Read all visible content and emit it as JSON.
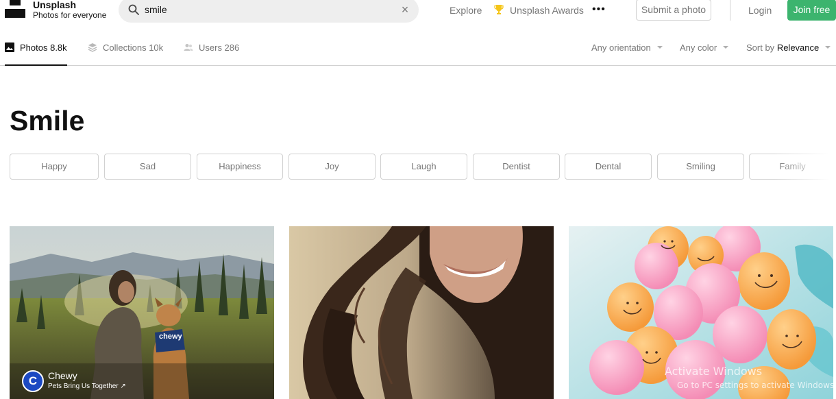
{
  "header": {
    "brand_name": "Unsplash",
    "brand_tagline": "Photos for everyone",
    "search_value": "smile",
    "nav": {
      "explore": "Explore",
      "awards": "Unsplash Awards",
      "more": "•••",
      "submit": "Submit a photo",
      "login": "Login",
      "join": "Join free"
    }
  },
  "tabs": [
    {
      "label": "Photos 8.8k",
      "icon": "image-icon",
      "active": true
    },
    {
      "label": "Collections 10k",
      "icon": "stack-icon",
      "active": false
    },
    {
      "label": "Users 286",
      "icon": "users-icon",
      "active": false
    }
  ],
  "filters": {
    "orientation": "Any orientation",
    "color": "Any color",
    "sort_prefix": "Sort by",
    "sort_value": "Relevance"
  },
  "page_title": "Smile",
  "related_searches": [
    "Happy",
    "Sad",
    "Happiness",
    "Joy",
    "Laugh",
    "Dentist",
    "Dental",
    "Smiling",
    "Family"
  ],
  "photos": [
    {
      "sponsor": "Chewy",
      "sponsor_line": "Pets Bring Us Together ↗",
      "sponsor_initial": "C",
      "collar_text": "chewy"
    },
    {},
    {}
  ],
  "watermark": {
    "line1": "Activate Windows",
    "line2": "Go to PC settings to activate Windows."
  },
  "colors": {
    "accent_green": "#3cb46e",
    "text_muted": "#767676",
    "sponsor_blue": "#1c49c2"
  }
}
